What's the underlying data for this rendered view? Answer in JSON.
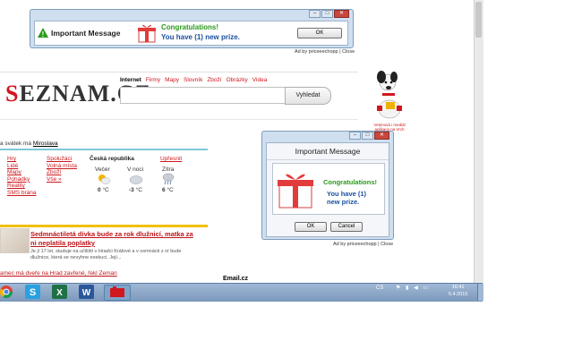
{
  "top_ad": {
    "title": "Important Message",
    "congrats": "Congratulations!",
    "prize": "You have (1) new prize.",
    "ok": "OK",
    "footer": "Ad by priceeechopp | Close"
  },
  "popup": {
    "title": "Important Message",
    "congrats": "Congratulations!",
    "prize_line1": "You have (1)",
    "prize_line2": "new prize.",
    "ok": "OK",
    "cancel": "Cancel",
    "footer": "Ad by priceeechopp | Close"
  },
  "seznam": {
    "logo": "SEZNAM.CZ",
    "tabs": [
      "Internet",
      "Firmy",
      "Mapy",
      "Slovník",
      "Zboží",
      "Obrázky",
      "Videa"
    ],
    "search_button": "Vyhledat",
    "namesday_prefix": "a   svátek má",
    "namesday_name": "Miroslava",
    "links_col1": [
      "Hry",
      "Lidé",
      "Mapy",
      "Pohádky",
      "Reality",
      "SMS brána"
    ],
    "links_col2": [
      "Spolužáci",
      "Volná místa",
      "Zboží",
      "Vše »"
    ],
    "weather": {
      "region": "Česká republika",
      "refine": "Upřesnit",
      "periods": [
        {
          "label": "Večer",
          "temp": "0",
          "unit": "°C"
        },
        {
          "label": "V noci",
          "temp": "-3",
          "unit": "°C"
        },
        {
          "label": "Zítra",
          "temp": "6",
          "unit": "°C"
        }
      ]
    },
    "news_title": "Sedmnáctiletá dívka bude za rok dlužnicí, matka za ni neplatila poplatky",
    "news_text": "Je jí 17 let, studuje na učilišti v Hradci Králové a v osmnácti z ní bude dlužnice, která se nevyhne exekuci. Její...",
    "bottom_link": "amec má dveře na Hrad zavřené, řekl Zeman",
    "email": "Email.cz",
    "dog_text": "Vetsnová i mediál aplikace na Vrch"
  },
  "taskbar": {
    "lang": "CS",
    "time": "16:41",
    "date": "5.4.2015"
  },
  "colors": {
    "seznam_red": "#d0181e",
    "congrats_green": "#2a9a1a",
    "prize_blue": "#1a4fa0",
    "taskbar": "#8ea9c8"
  }
}
